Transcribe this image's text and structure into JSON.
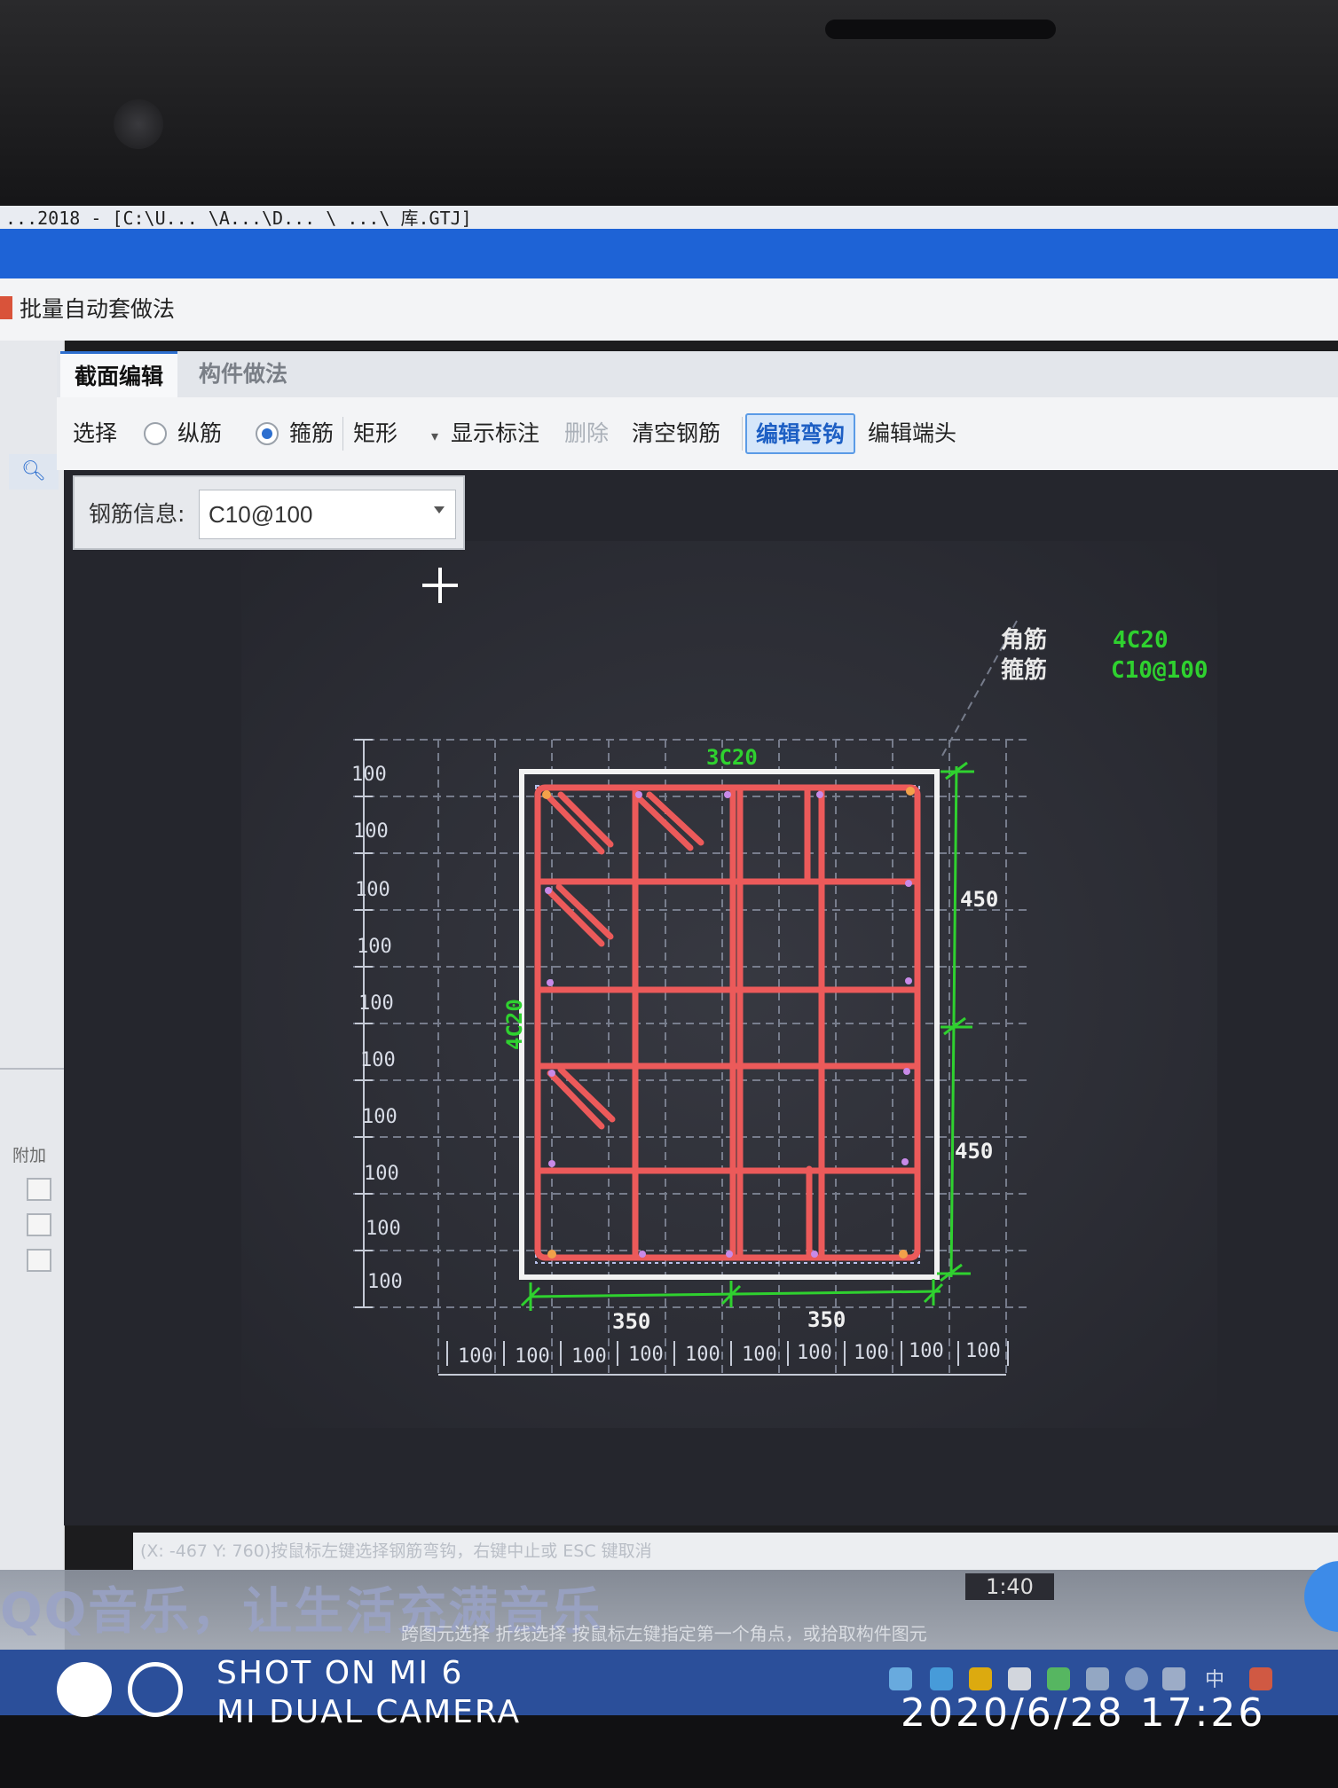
{
  "window": {
    "partial_title": "...2018 - [C:\\U... \\A...\\D... \\ ...\\ 库.GTJ]",
    "dialog_title": "批量自动套做法"
  },
  "tabs": [
    {
      "label": "截面编辑",
      "active": true
    },
    {
      "label": "构件做法",
      "active": false
    }
  ],
  "toolbar": {
    "select": "选择",
    "longitudinal": "纵筋",
    "stirrup": "箍筋",
    "shape": "矩形",
    "show_annotation": "显示标注",
    "delete": "删除",
    "clear_rebar": "清空钢筋",
    "edit_hook": "编辑弯钩",
    "edit_end": "编辑端头",
    "selected_mode": "stirrup"
  },
  "rebar_info": {
    "label": "钢筋信息:",
    "value": "C10@100"
  },
  "left_panel": {
    "addon_label": "附加"
  },
  "drawing": {
    "legend": {
      "corner_label": "角筋",
      "corner_value": "4C20",
      "stirrup_label": "箍筋",
      "stirrup_value": "C10@100"
    },
    "top_rebar": "3C20",
    "side_rebar": "4C20",
    "right_dims": [
      "450",
      "450"
    ],
    "bottom_dims": [
      "350",
      "350"
    ],
    "left_grid": [
      "100",
      "100",
      "100",
      "100",
      "100",
      "100",
      "100",
      "100",
      "100",
      "100"
    ],
    "bottom_grid": [
      "100",
      "100",
      "100",
      "100",
      "100",
      "100",
      "100",
      "100",
      "100",
      "100"
    ]
  },
  "status": {
    "hint": "(X: -467 Y: 760)按鼠标左键选择钢筋弯钩，右键中止或 ESC 键取消",
    "hint2": "跨图元选择   折线选择   按鼠标左键指定第一个角点，或拾取构件图元",
    "zoom": "1:40",
    "overlay": "QQ音乐，让生活充满音乐"
  },
  "taskbar": {
    "ime": "中"
  },
  "watermark": {
    "line1": "SHOT ON MI 6",
    "line2": "MI DUAL CAMERA",
    "datetime": "2020/6/28  17:26"
  },
  "colors": {
    "title_blue": "#1e63d6",
    "canvas": "#25262d",
    "rebar_red": "#ec5a5a",
    "dim_green": "#2fd12f",
    "accent": "#2d6fcf"
  }
}
